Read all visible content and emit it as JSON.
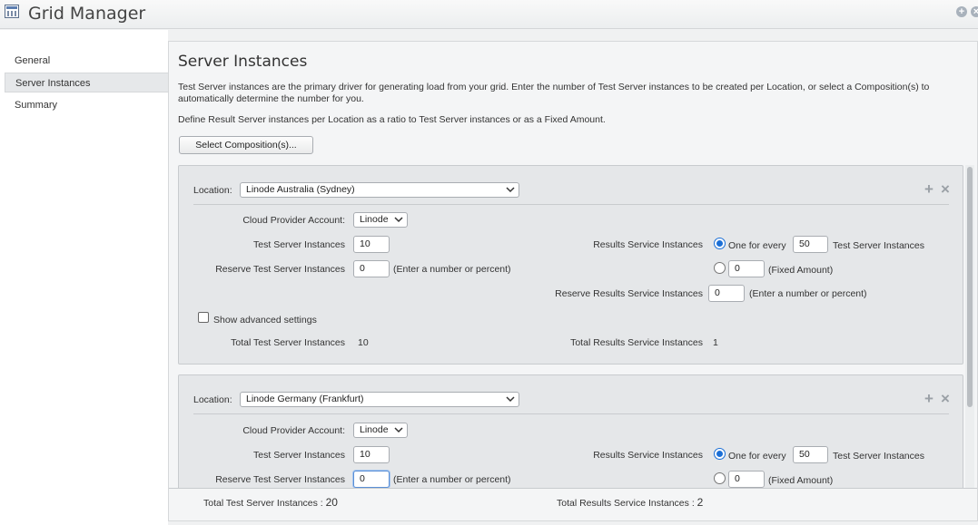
{
  "app": {
    "title": "Grid Manager"
  },
  "nav": {
    "items": [
      "General",
      "Server Instances",
      "Summary"
    ]
  },
  "main": {
    "title": "Server Instances",
    "desc1": "Test Server instances are the primary driver for generating load from your grid. Enter the number of Test Server instances to be created per Location, or select a Composition(s) to automatically determine the number for you.",
    "desc2": "Define Result Server instances per Location as a ratio to Test Server instances or as a Fixed Amount.",
    "select_button": "Select Composition(s)..."
  },
  "labels": {
    "location": "Location:",
    "cloud_account": "Cloud Provider Account:",
    "test_servers": "Test Server Instances",
    "reserve_test": "Reserve Test Server Instances",
    "enter_number": "(Enter a number or percent)",
    "results_service": "Results Service Instances",
    "one_for_every": "One for every",
    "test_server_instances": "Test Server Instances",
    "fixed_amount": "(Fixed Amount)",
    "reserve_results": "Reserve Results Service Instances",
    "show_advanced": "Show advanced settings",
    "total_test": "Total Test Server Instances",
    "total_results": "Total Results Service Instances"
  },
  "locations": [
    {
      "name": "Linode Australia (Sydney)",
      "account": "Linode",
      "test_servers": "10",
      "reserve_test": "0",
      "ratio": "50",
      "fixed": "0",
      "reserve_results": "0",
      "total_test": "10",
      "total_results": "1"
    },
    {
      "name": "Linode Germany (Frankfurt)",
      "account": "Linode",
      "test_servers": "10",
      "reserve_test": "0",
      "ratio": "50",
      "fixed": "0"
    }
  ],
  "footer": {
    "total_test_label": "Total Test Server Instances :",
    "total_test_value": "20",
    "total_results_label": "Total Results Service Instances :",
    "total_results_value": "2"
  },
  "icons": {
    "add": "plus-icon",
    "remove": "close-icon",
    "dropdown": "chevron-down-icon"
  },
  "colors": {
    "accent": "#1b6fd6",
    "panel": "#e5e7e9"
  }
}
